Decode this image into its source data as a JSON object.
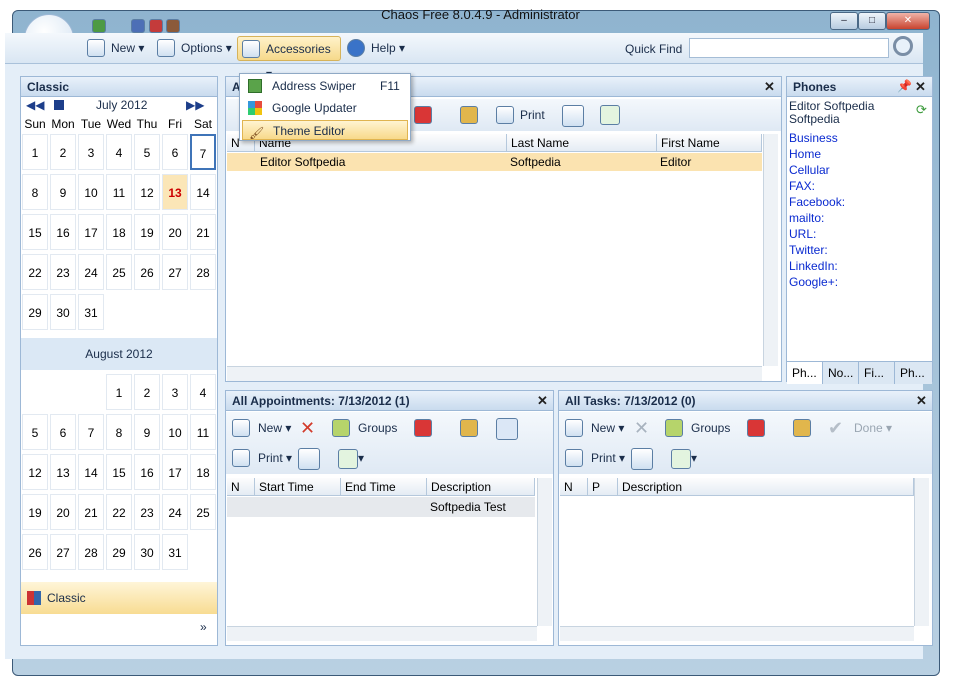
{
  "window": {
    "title": "Chaos Free 8.0.4.9 - Administrator",
    "minimize": "–",
    "maximize": "□",
    "close": "✕"
  },
  "toolbar": {
    "new_label": "New",
    "options_label": "Options",
    "accessories_label": "Accessories",
    "help_label": "Help",
    "quick_find_label": "Quick Find",
    "quick_find_value": ""
  },
  "accessories_menu": [
    {
      "label": "Address Swiper",
      "shortcut": "F11"
    },
    {
      "label": "Google Updater",
      "shortcut": ""
    },
    {
      "label": "Theme Editor",
      "shortcut": ""
    }
  ],
  "calendar": {
    "header": "Classic",
    "days_of_week": [
      "Sun",
      "Mon",
      "Tue",
      "Wed",
      "Thu",
      "Fri",
      "Sat"
    ],
    "month1": "July 2012",
    "month1_days": [
      [
        "1",
        "2",
        "3",
        "4",
        "5",
        "6",
        "7"
      ],
      [
        "8",
        "9",
        "10",
        "11",
        "12",
        "13",
        "14"
      ],
      [
        "15",
        "16",
        "17",
        "18",
        "19",
        "20",
        "21"
      ],
      [
        "22",
        "23",
        "24",
        "25",
        "26",
        "27",
        "28"
      ],
      [
        "29",
        "30",
        "31",
        "",
        "",
        "",
        ""
      ]
    ],
    "today": "13",
    "month2": "August 2012",
    "month2_days": [
      [
        "",
        "",
        "",
        "1",
        "2",
        "3",
        "4"
      ],
      [
        "5",
        "6",
        "7",
        "8",
        "9",
        "10",
        "11"
      ],
      [
        "12",
        "13",
        "14",
        "15",
        "16",
        "17",
        "18"
      ],
      [
        "19",
        "20",
        "21",
        "22",
        "23",
        "24",
        "25"
      ],
      [
        "26",
        "27",
        "28",
        "29",
        "30",
        "31",
        ""
      ]
    ],
    "nav_item": "Classic"
  },
  "contacts": {
    "tab_label": "Al",
    "print_label": "Print",
    "columns": [
      "N",
      "Name",
      "Last Name",
      "First Name"
    ],
    "rows": [
      {
        "n": "",
        "name": "Editor Softpedia",
        "last": "Softpedia",
        "first": "Editor"
      }
    ]
  },
  "phones": {
    "header": "Phones",
    "contact_line1": "Editor Softpedia",
    "contact_line2": "Softpedia",
    "fields": [
      "Business",
      "Home",
      "Cellular",
      "FAX:",
      "Facebook:",
      "mailto:",
      "URL:",
      "Twitter:",
      "LinkedIn:",
      "Google+:"
    ],
    "tabs": [
      "Ph...",
      "No...",
      "Fi...",
      "Ph..."
    ]
  },
  "appointments": {
    "header": "All Appointments: 7/13/2012  (1)",
    "new_label": "New",
    "groups_label": "Groups",
    "print_label": "Print",
    "columns": [
      "N",
      "Start Time",
      "End Time",
      "Description"
    ],
    "rows": [
      {
        "description": "Softpedia Test"
      }
    ]
  },
  "tasks": {
    "header": "All Tasks: 7/13/2012  (0)",
    "new_label": "New",
    "groups_label": "Groups",
    "done_label": "Done",
    "print_label": "Print",
    "columns": [
      "N",
      "P",
      "Description"
    ]
  },
  "colors": {
    "accent": "#c9dbee",
    "today_bg": "#fbe6b7",
    "today_text": "#cc0000",
    "selected_row": "#fbe3b0",
    "link": "#0a2ad0"
  }
}
